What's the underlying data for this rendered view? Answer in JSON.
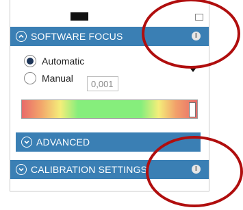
{
  "software_focus": {
    "header_label": "SOFTWARE FOCUS",
    "info_label": "I",
    "mode_options": [
      {
        "label": "Automatic",
        "selected": true
      },
      {
        "label": "Manual",
        "selected": false
      }
    ],
    "manual_value": "0,001",
    "focus_level": 0.98
  },
  "advanced": {
    "header_label": "ADVANCED"
  },
  "calibration": {
    "header_label": "CALIBRATION SETTINGS",
    "info_label": "I"
  },
  "colors": {
    "header_bg": "#3a7fb4",
    "annotation": "#b00e0e"
  },
  "icons": [
    "chevron-up-icon",
    "chevron-down-icon",
    "info-icon",
    "dropdown-arrow-icon"
  ]
}
